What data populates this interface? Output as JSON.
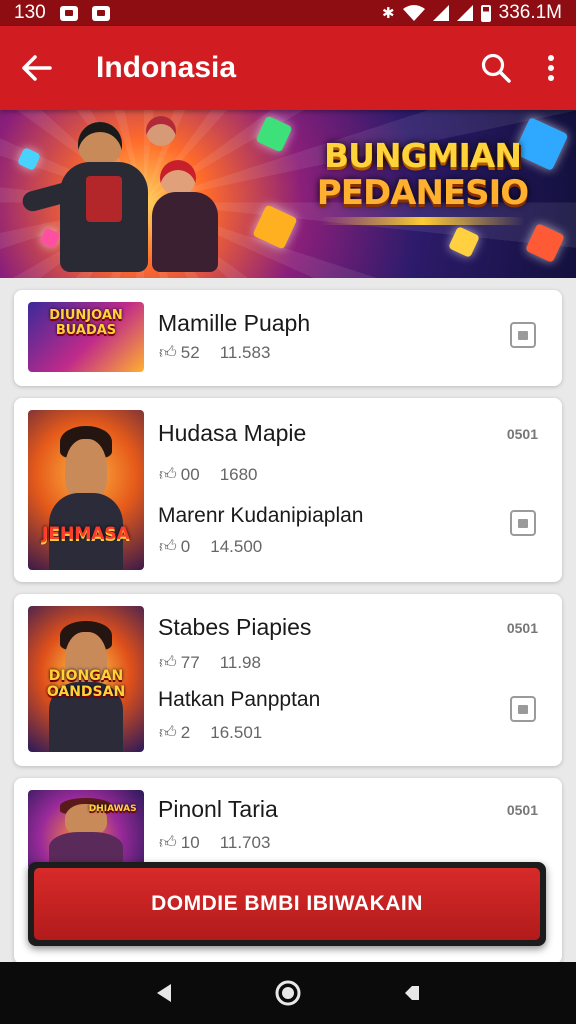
{
  "status_bar": {
    "time": "130",
    "right_text": "336.1M"
  },
  "app_bar": {
    "title": "Indonasia"
  },
  "banner": {
    "title_line1": "BUNGMIAN",
    "title_line2": "PEDANESIO"
  },
  "items": [
    {
      "thumb_text": "DIUNJOAN BUADAS",
      "title": "Mamille Puaph",
      "meta1": "52",
      "meta2": "11.583"
    },
    {
      "thumb_text": "JEHMASA",
      "title": "Hudasa Mapie",
      "meta1": "00",
      "meta2": "1680",
      "badge": "0501",
      "sub_title": "Marenr Kudanipiaplan",
      "sub_meta1": "0",
      "sub_meta2": "14.500"
    },
    {
      "thumb_text": "DIONGAN OANDSAN",
      "title": "Stabes Piapies",
      "meta1": "77",
      "meta2": "11.98",
      "badge": "0501",
      "sub_title": "Hatkan Panpptan",
      "sub_meta1": "2",
      "sub_meta2": "16.501"
    },
    {
      "thumb_text": "DHIAWAS",
      "title": "Pinonl Taria",
      "meta1": "10",
      "meta2": "11.703",
      "badge": "0501"
    }
  ],
  "cta": {
    "label": "DOMDIE BMBI IBIWAKAIN"
  },
  "colors": {
    "app_bar": "#d11d22",
    "status_bar": "#8e0d12",
    "cta": "#c62121",
    "nav_bar": "#0b0b0b"
  }
}
